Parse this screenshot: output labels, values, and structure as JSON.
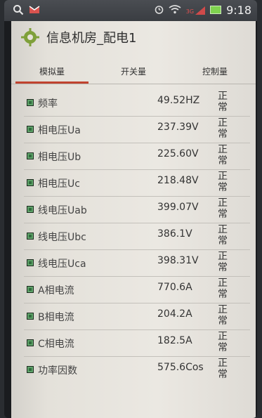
{
  "statusbar": {
    "time": "9:18",
    "network": "3G"
  },
  "header": {
    "title": "信息机房_配电1"
  },
  "tabs": [
    {
      "label": "模拟量",
      "active": true
    },
    {
      "label": "开关量",
      "active": false
    },
    {
      "label": "控制量",
      "active": false
    }
  ],
  "rows": [
    {
      "label": "频率",
      "value": "49.52HZ",
      "status": "正常"
    },
    {
      "label": "相电压Ua",
      "value": "237.39V",
      "status": "正常"
    },
    {
      "label": "相电压Ub",
      "value": "225.60V",
      "status": "正常"
    },
    {
      "label": "相电压Uc",
      "value": "218.48V",
      "status": "正常"
    },
    {
      "label": "线电压Uab",
      "value": "399.07V",
      "status": "正常"
    },
    {
      "label": "线电压Ubc",
      "value": "386.1V",
      "status": "正常"
    },
    {
      "label": "线电压Uca",
      "value": "398.31V",
      "status": "正常"
    },
    {
      "label": "A相电流",
      "value": "770.6A",
      "status": "正常"
    },
    {
      "label": "B相电流",
      "value": "204.2A",
      "status": "正常"
    },
    {
      "label": "C相电流",
      "value": "182.5A",
      "status": "正常"
    },
    {
      "label": "功率因数",
      "value": "575.6Cos",
      "status": "正常"
    }
  ],
  "colors": {
    "accent": "#c0432f",
    "indicator": "#2f6b3c"
  }
}
